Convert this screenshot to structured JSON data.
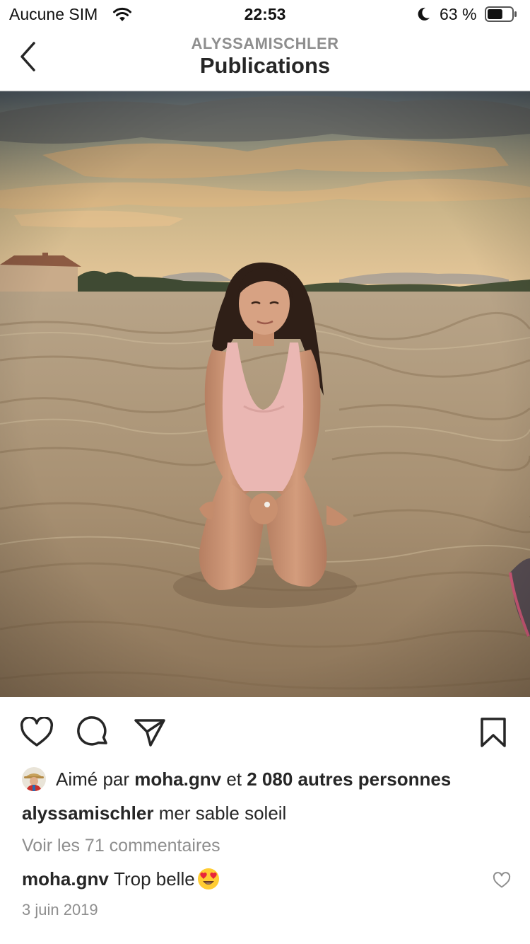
{
  "status_bar": {
    "carrier": "Aucune SIM",
    "time": "22:53",
    "battery_percent": "63 %",
    "battery_level": 0.63,
    "icons": [
      "wifi-icon",
      "moon-icon",
      "battery-icon"
    ]
  },
  "header": {
    "subtitle": "ALYSSAMISCHLER",
    "title": "Publications",
    "back_icon": "chevron-left-icon"
  },
  "post": {
    "actions": [
      "heart-icon",
      "comment-icon",
      "share-icon",
      "bookmark-icon"
    ],
    "likes": {
      "prefix": "Aimé par",
      "user": "moha.gnv",
      "connector": "et",
      "others": "2 080 autres personnes"
    },
    "caption": {
      "username": "alyssamischler",
      "text": "mer sable soleil"
    },
    "view_comments": "Voir les 71 commentaires",
    "comment": {
      "username": "moha.gnv",
      "text": "Trop belle",
      "emoji": "heart-eyes-emoji"
    },
    "date": "3 juin 2019"
  },
  "colors": {
    "text": "#262626",
    "secondary": "#8e8e8e",
    "divider": "#dbdbdb"
  }
}
